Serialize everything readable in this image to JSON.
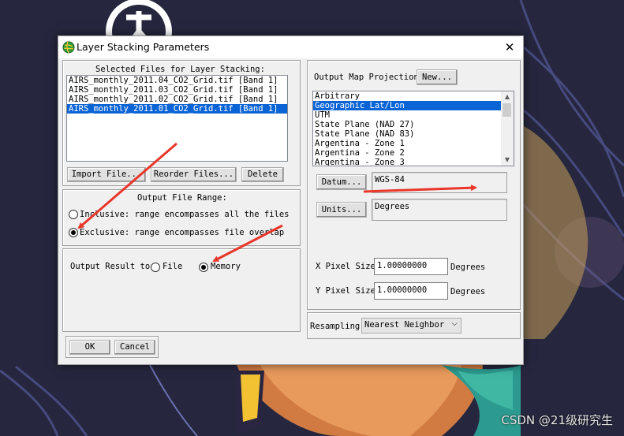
{
  "window": {
    "title": "Layer Stacking Parameters",
    "close_glyph": "✕",
    "icon": "app-globe-icon"
  },
  "selected_files": {
    "heading": "Selected Files for Layer Stacking:",
    "items": [
      "AIRS_monthly_2011.04_CO2_Grid.tif [Band 1]",
      "AIRS_monthly_2011.03_CO2_Grid.tif [Band 1]",
      "AIRS_monthly_2011.02_CO2_Grid.tif [Band 1]",
      "AIRS_monthly_2011.01_CO2_Grid.tif [Band 1]"
    ],
    "selected_index": 3,
    "import_label": "Import File...",
    "reorder_label": "Reorder Files...",
    "delete_label": "Delete"
  },
  "output_range": {
    "heading": "Output File Range:",
    "inclusive_label": "Inclusive: range encompasses all the files",
    "exclusive_label": "Exclusive: range encompasses file overlap",
    "selected": "exclusive"
  },
  "output_result": {
    "label": "Output Result to",
    "file_label": "File",
    "memory_label": "Memory",
    "selected": "memory"
  },
  "footer": {
    "ok_label": "OK",
    "cancel_label": "Cancel"
  },
  "projection": {
    "label": "Output Map Projection",
    "new_label": "New...",
    "items": [
      "Arbitrary",
      "Geographic Lat/Lon",
      "UTM",
      "State Plane (NAD 27)",
      "State Plane (NAD 83)",
      "Argentina - Zone 1",
      "Argentina - Zone 2",
      "Argentina - Zone 3"
    ],
    "selected_index": 1,
    "datum_label": "Datum...",
    "datum_value": "WGS-84",
    "units_label": "Units...",
    "units_value": "Degrees"
  },
  "pixel_size": {
    "x_label": "X Pixel Size",
    "x_value": "1.00000000",
    "x_unit": "Degrees",
    "y_label": "Y Pixel Size",
    "y_value": "1.00000000",
    "y_unit": "Degrees"
  },
  "resampling": {
    "label": "Resampling",
    "value": "Nearest Neighbor"
  },
  "watermark": "CSDN @21级研究生",
  "colors": {
    "selection": "#0a64d6",
    "arrow": "#e8362a",
    "background": "#26263e"
  }
}
